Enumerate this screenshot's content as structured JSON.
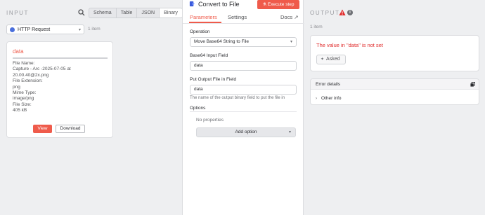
{
  "input": {
    "title": "INPUT",
    "modes": [
      "Schema",
      "Table",
      "JSON",
      "Binary"
    ],
    "active_mode": "Binary",
    "node_select": "HTTP Request",
    "item_count": "1 item",
    "binary": {
      "title": "data",
      "meta_lines": [
        "File Name:",
        "Capture - Arc -2025-07-05 at",
        "20.00.40@2x.png",
        "File Extension:",
        "png",
        "Mime Type:",
        "image/png",
        "File Size:",
        "405 kB"
      ],
      "view_label": "View",
      "download_label": "Download"
    }
  },
  "node": {
    "name": "Convert to File",
    "execute_label": "Execute step",
    "tabs": [
      "Parameters",
      "Settings"
    ],
    "active_tab": "Parameters",
    "docs_label": "Docs",
    "operation_label": "Operation",
    "operation_value": "Move Base64 String to File",
    "base64_label": "Base64 Input Field",
    "base64_value": "data",
    "put_output_label": "Put Output File in Field",
    "put_output_value": "data",
    "put_output_hint": "The name of the output binary field to put the file in",
    "options_label": "Options",
    "no_properties": "No properties",
    "add_option_label": "Add option"
  },
  "output": {
    "title": "OUTPUT",
    "item_count": "1 item",
    "error_message": "The value in \"data\" is not set",
    "asked_label": "Asked",
    "error_details_label": "Error details",
    "other_info_label": "Other info"
  },
  "colors": {
    "accent": "#ef5b4b",
    "error_text": "#e02b2b"
  }
}
